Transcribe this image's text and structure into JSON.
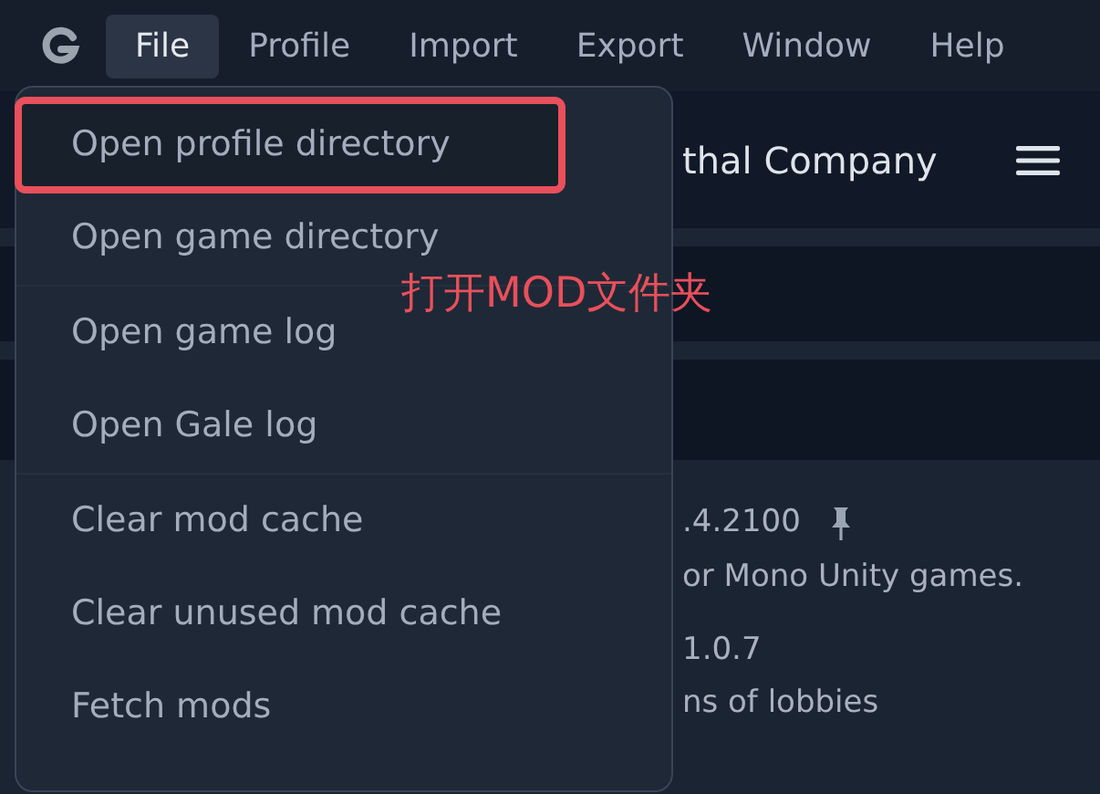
{
  "menu_bar": [
    {
      "label": "File",
      "selected": true
    },
    {
      "label": "Profile",
      "selected": false
    },
    {
      "label": "Import",
      "selected": false
    },
    {
      "label": "Export",
      "selected": false
    },
    {
      "label": "Window",
      "selected": false
    },
    {
      "label": "Help",
      "selected": false
    }
  ],
  "header": {
    "title": "thal Company"
  },
  "mods": [
    {
      "version": ".4.2100",
      "pinned": true,
      "description": "or Mono Unity games."
    },
    {
      "version": "1.0.7",
      "pinned": false,
      "description": "ns of lobbies"
    }
  ],
  "file_menu": {
    "groups": [
      [
        {
          "label": "Open profile directory",
          "highlighted": true
        },
        {
          "label": "Open game directory",
          "highlighted": false
        }
      ],
      [
        {
          "label": "Open game log",
          "highlighted": false
        },
        {
          "label": "Open Gale log",
          "highlighted": false
        }
      ],
      [
        {
          "label": "Clear mod cache",
          "highlighted": false
        },
        {
          "label": "Clear unused mod cache",
          "highlighted": false
        },
        {
          "label": "Fetch mods",
          "highlighted": false
        }
      ]
    ]
  },
  "annotation": {
    "text": "打开MOD文件夹"
  }
}
